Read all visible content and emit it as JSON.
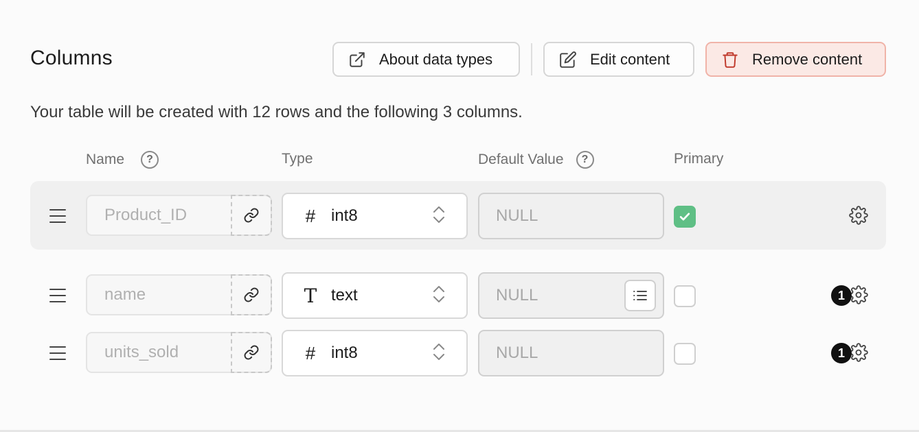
{
  "header": {
    "title": "Columns",
    "about_label": "About data types",
    "edit_label": "Edit content",
    "remove_label": "Remove content"
  },
  "subtitle": "Your table will be created with 12 rows and the following 3 columns.",
  "columns_header": {
    "name": "Name",
    "type": "Type",
    "default_value": "Default Value",
    "primary": "Primary",
    "help_glyph": "?"
  },
  "rows": [
    {
      "name": "Product_ID",
      "type": "int8",
      "type_icon": "#",
      "default": "NULL",
      "primary": true,
      "badge": ""
    },
    {
      "name": "name",
      "type": "text",
      "type_icon": "T",
      "default": "NULL",
      "primary": false,
      "badge": "1"
    },
    {
      "name": "units_sold",
      "type": "int8",
      "type_icon": "#",
      "default": "NULL",
      "primary": false,
      "badge": "1"
    }
  ],
  "colors": {
    "primary_check": "#5fbf85",
    "remove_bg": "#fbe9e5",
    "remove_border": "#f0b3a8",
    "remove_icon": "#c0392b"
  }
}
